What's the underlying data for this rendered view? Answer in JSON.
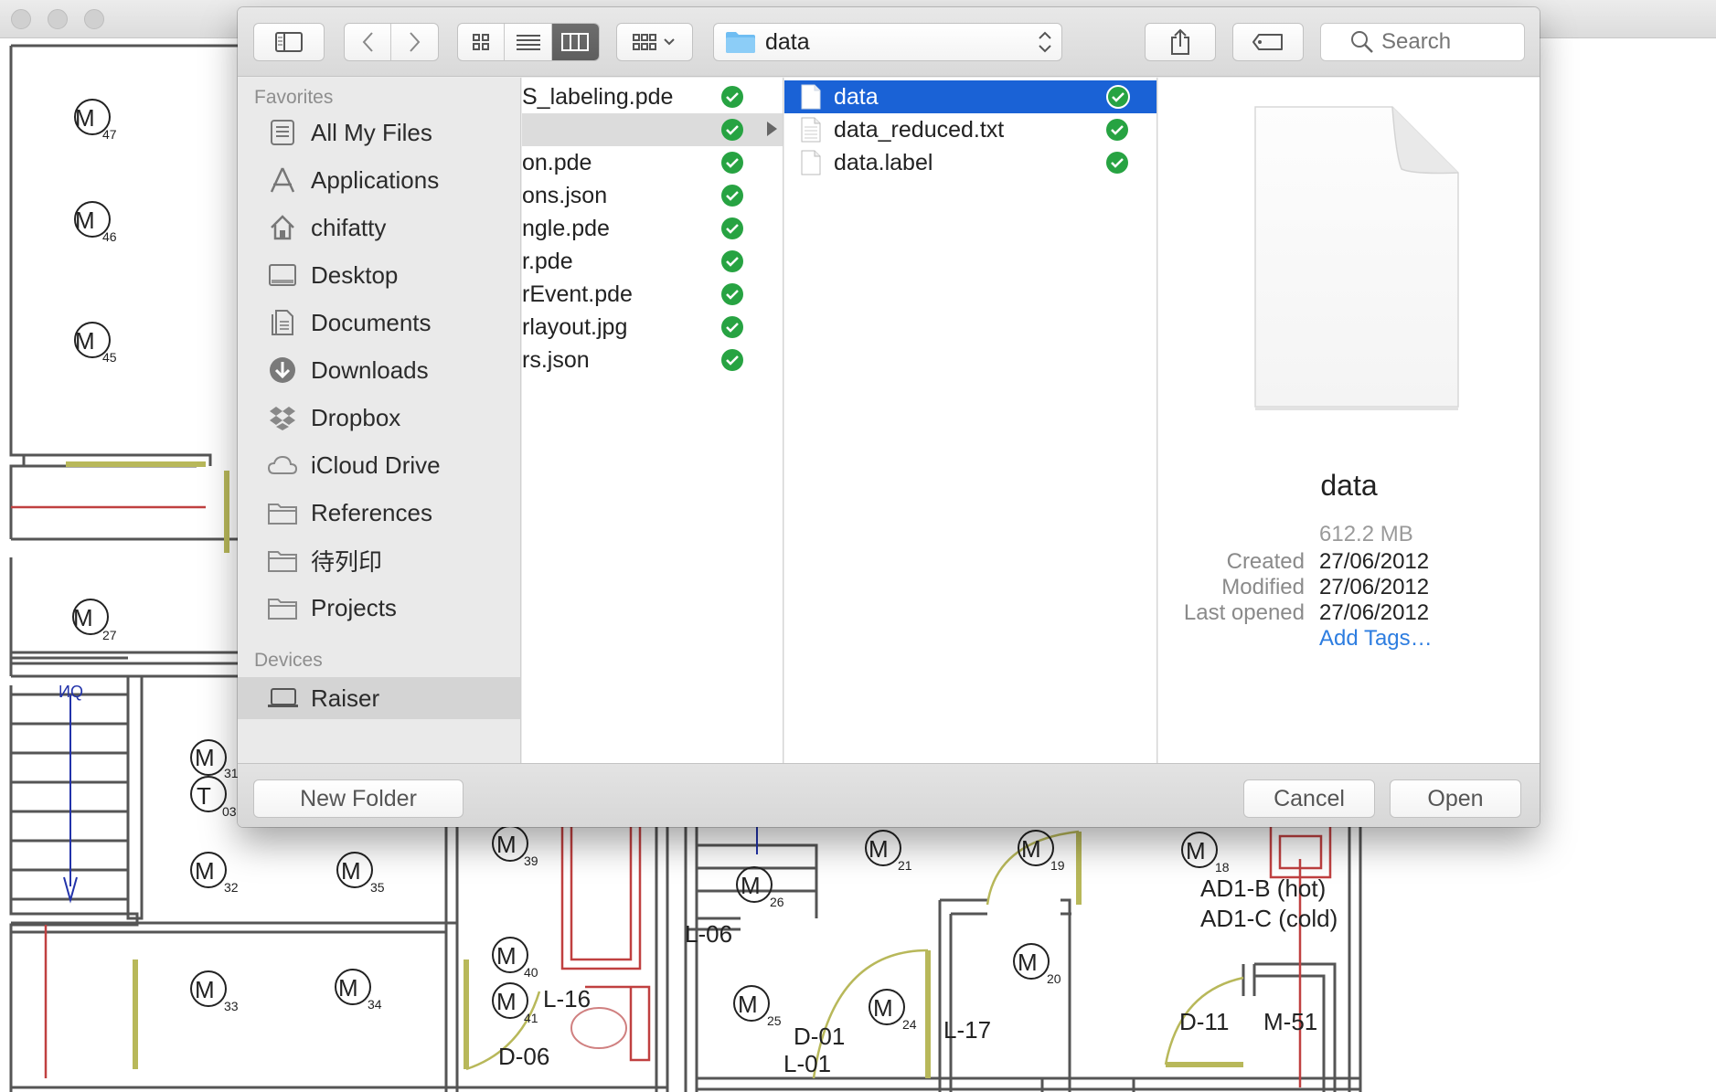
{
  "toolbar": {
    "path_folder": "data",
    "search_placeholder": "Search"
  },
  "sidebar": {
    "favorites_header": "Favorites",
    "favorites": [
      {
        "label": "All My Files",
        "icon": "all-files-icon"
      },
      {
        "label": "Applications",
        "icon": "applications-icon"
      },
      {
        "label": "chifatty",
        "icon": "home-icon"
      },
      {
        "label": "Desktop",
        "icon": "desktop-icon"
      },
      {
        "label": "Documents",
        "icon": "documents-icon"
      },
      {
        "label": "Downloads",
        "icon": "downloads-icon"
      },
      {
        "label": "Dropbox",
        "icon": "dropbox-icon"
      },
      {
        "label": "iCloud Drive",
        "icon": "icloud-icon"
      },
      {
        "label": "References",
        "icon": "folder-icon"
      },
      {
        "label": "待列印",
        "icon": "folder-icon"
      },
      {
        "label": "Projects",
        "icon": "folder-icon"
      }
    ],
    "devices_header": "Devices",
    "devices": [
      {
        "label": "Raiser",
        "icon": "laptop-icon",
        "selected": true
      }
    ]
  },
  "column1": {
    "items": [
      {
        "name": "S_labeling.pde"
      },
      {
        "name": "",
        "selected": true,
        "folder": true
      },
      {
        "name": "on.pde"
      },
      {
        "name": "ons.json"
      },
      {
        "name": "ngle.pde"
      },
      {
        "name": "r.pde"
      },
      {
        "name": "rEvent.pde"
      },
      {
        "name": "rlayout.jpg"
      },
      {
        "name": "rs.json"
      }
    ]
  },
  "column2": {
    "items": [
      {
        "name": "data",
        "selected": true
      },
      {
        "name": "data_reduced.txt"
      },
      {
        "name": "data.label"
      }
    ]
  },
  "preview": {
    "name": "data",
    "size": "612.2 MB",
    "created_label": "Created",
    "created": "27/06/2012",
    "modified_label": "Modified",
    "modified": "27/06/2012",
    "last_opened_label": "Last opened",
    "last_opened": "27/06/2012",
    "add_tags": "Add Tags…"
  },
  "buttons": {
    "new_folder": "New Folder",
    "cancel": "Cancel",
    "open": "Open"
  },
  "background": {
    "labels": {
      "m47": "M",
      "s47": "47",
      "m46": "M",
      "s46": "46",
      "m45": "M",
      "s45": "45",
      "m27": "M",
      "s27": "27",
      "stair": "ИQ",
      "m31": "M",
      "s31": "31",
      "t03": "T",
      "s03": "03",
      "m32": "M",
      "s32": "32",
      "m35": "M",
      "s35": "35",
      "m33": "M",
      "s33": "33",
      "m34": "M",
      "s34": "34",
      "m39": "M",
      "s39": "39",
      "m40": "M",
      "s40": "40",
      "m41": "M",
      "s41": "41",
      "m26": "M",
      "s26": "26",
      "m21": "M",
      "s21": "21",
      "m19": "M",
      "s19": "19",
      "m18": "M",
      "s18": "18",
      "m20": "M",
      "s20": "20",
      "m25": "M",
      "s25": "25",
      "m24": "M",
      "s24": "24",
      "l16": "L-16",
      "d06": "D-06",
      "l06": "L-06",
      "d01": "D-01",
      "l01": "L-01",
      "l17": "L-17",
      "ad1b": "AD1-B (hot)",
      "ad1c": "AD1-C (cold)",
      "d11": "D-11",
      "m51": "M-51"
    }
  }
}
